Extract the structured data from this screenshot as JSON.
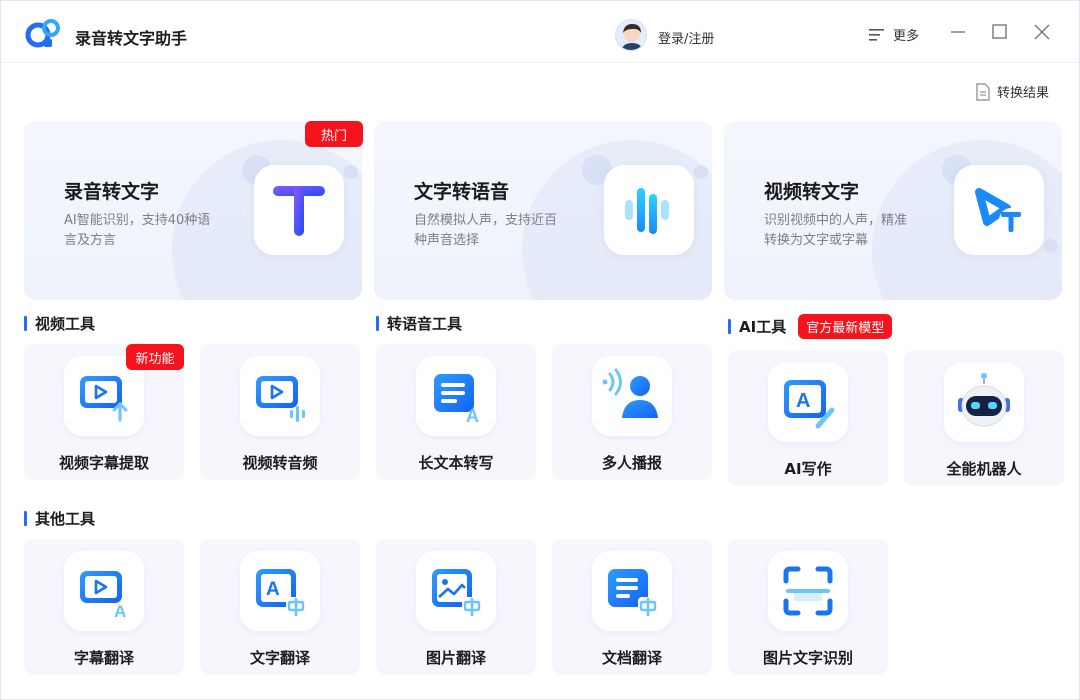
{
  "app": {
    "title": "录音转文字助手"
  },
  "header": {
    "login_label": "登录/注册",
    "more_label": "更多"
  },
  "result_link": "转换结果",
  "big_cards": [
    {
      "title": "录音转文字",
      "desc": "AI智能识别，支持40种语言及方言",
      "icon": "letter-t-icon",
      "badge": "热门"
    },
    {
      "title": "文字转语音",
      "desc": "自然模拟人声，支持近百种声音选择",
      "icon": "sound-wave-icon"
    },
    {
      "title": "视频转文字",
      "desc": "识别视频中的人声，精准转换为文字或字幕",
      "icon": "video-text-icon"
    }
  ],
  "sections": {
    "video_tools": "视频工具",
    "tts_tools": "转语音工具",
    "ai_tools": "AI工具",
    "ai_badge": "官方最新模型",
    "other_tools": "其他工具"
  },
  "tools": {
    "subtitle_extract": {
      "label": "视频字幕提取",
      "badge": "新功能"
    },
    "video_to_audio": {
      "label": "视频转音频"
    },
    "long_text": {
      "label": "长文本转写"
    },
    "multi_speaker": {
      "label": "多人播报"
    },
    "ai_writing": {
      "label": "AI写作"
    },
    "robot": {
      "label": "全能机器人"
    },
    "subtitle_translate": {
      "label": "字幕翻译"
    },
    "text_translate": {
      "label": "文字翻译"
    },
    "image_translate": {
      "label": "图片翻译"
    },
    "doc_translate": {
      "label": "文档翻译"
    },
    "ocr": {
      "label": "图片文字识别"
    }
  },
  "colors": {
    "accent": "#1e6ff2",
    "badge": "#f5141e",
    "card_bg": "#f5f7fc"
  }
}
